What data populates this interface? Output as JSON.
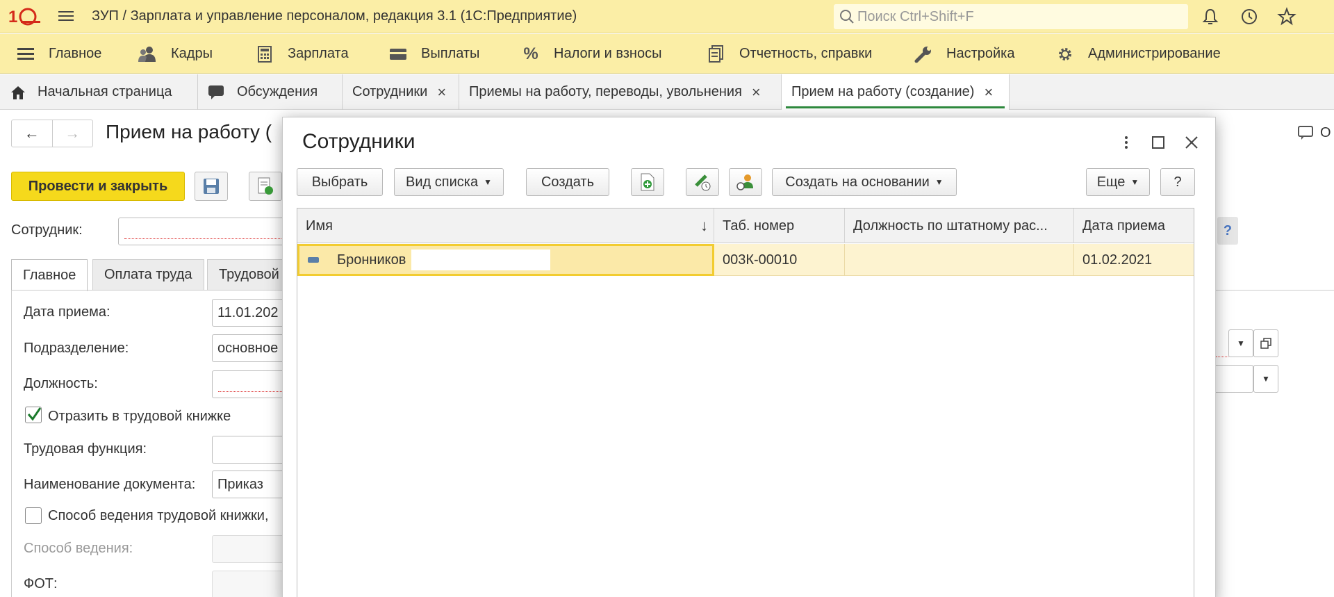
{
  "app": {
    "title": "ЗУП / Зарплата и управление персоналом, редакция 3.1  (1С:Предприятие)",
    "search_placeholder": "Поиск Ctrl+Shift+F",
    "icons": [
      "1c-logo-icon",
      "menu-icon",
      "bell-icon",
      "history-icon",
      "star-icon"
    ]
  },
  "sections": [
    {
      "label": "Главное",
      "icon": "menu-lines-icon"
    },
    {
      "label": "Кадры",
      "icon": "people-icon"
    },
    {
      "label": "Зарплата",
      "icon": "calculator-icon"
    },
    {
      "label": "Выплаты",
      "icon": "wallet-icon"
    },
    {
      "label": "Налоги и взносы",
      "icon": "percent-icon"
    },
    {
      "label": "Отчетность, справки",
      "icon": "documents-icon"
    },
    {
      "label": "Настройка",
      "icon": "wrench-icon"
    },
    {
      "label": "Администрирование",
      "icon": "gear-icon"
    }
  ],
  "tabs": [
    {
      "label": "Начальная страница",
      "icon": "home-icon"
    },
    {
      "label": "Обсуждения",
      "icon": "chat-icon"
    },
    {
      "label": "Сотрудники",
      "close": "×"
    },
    {
      "label": "Приемы на работу, переводы, увольнения",
      "close": "×"
    },
    {
      "label": "Прием на работу (создание)",
      "close": "×",
      "active": true
    }
  ],
  "document": {
    "title": "Прием на работу (",
    "post_close_label": "Провести и закрыть",
    "employee_label": "Сотрудник:",
    "right_link": "О",
    "help": "?",
    "form_tabs": [
      "Главное",
      "Оплата труда",
      "Трудовой"
    ],
    "fields": {
      "hire_date_label": "Дата приема:",
      "hire_date_value": "11.01.202",
      "department_label": "Подразделение:",
      "department_value": "основное",
      "position_label": "Должность:",
      "record_book_label": "Отразить в трудовой книжке",
      "labor_function_label": "Трудовая функция:",
      "doc_name_label": "Наименование документа:",
      "doc_name_value": "Приказ",
      "record_method_check_label": "Способ ведения трудовой книжки, ",
      "record_method_label": "Способ ведения:",
      "fot_label": "ФОТ:"
    }
  },
  "modal": {
    "title": "Сотрудники",
    "buttons": {
      "select": "Выбрать",
      "view": "Вид списка",
      "create": "Создать",
      "create_based": "Создать на основании",
      "more": "Еще",
      "help": "?"
    },
    "columns": [
      "Имя",
      "Таб. номер",
      "Должность по штатному рас...",
      "Дата приема"
    ],
    "sort_indicator": "↓",
    "rows": [
      {
        "name": "Бронников",
        "tab_no": "003К-00010",
        "position": "",
        "hire_date": "01.02.2021"
      }
    ]
  },
  "colors": {
    "header_bg": "#fbeea6",
    "accent_yellow": "#f5d91c",
    "active_tab_underline": "#2e8b3e",
    "selected_row": "#fdf3d0"
  }
}
